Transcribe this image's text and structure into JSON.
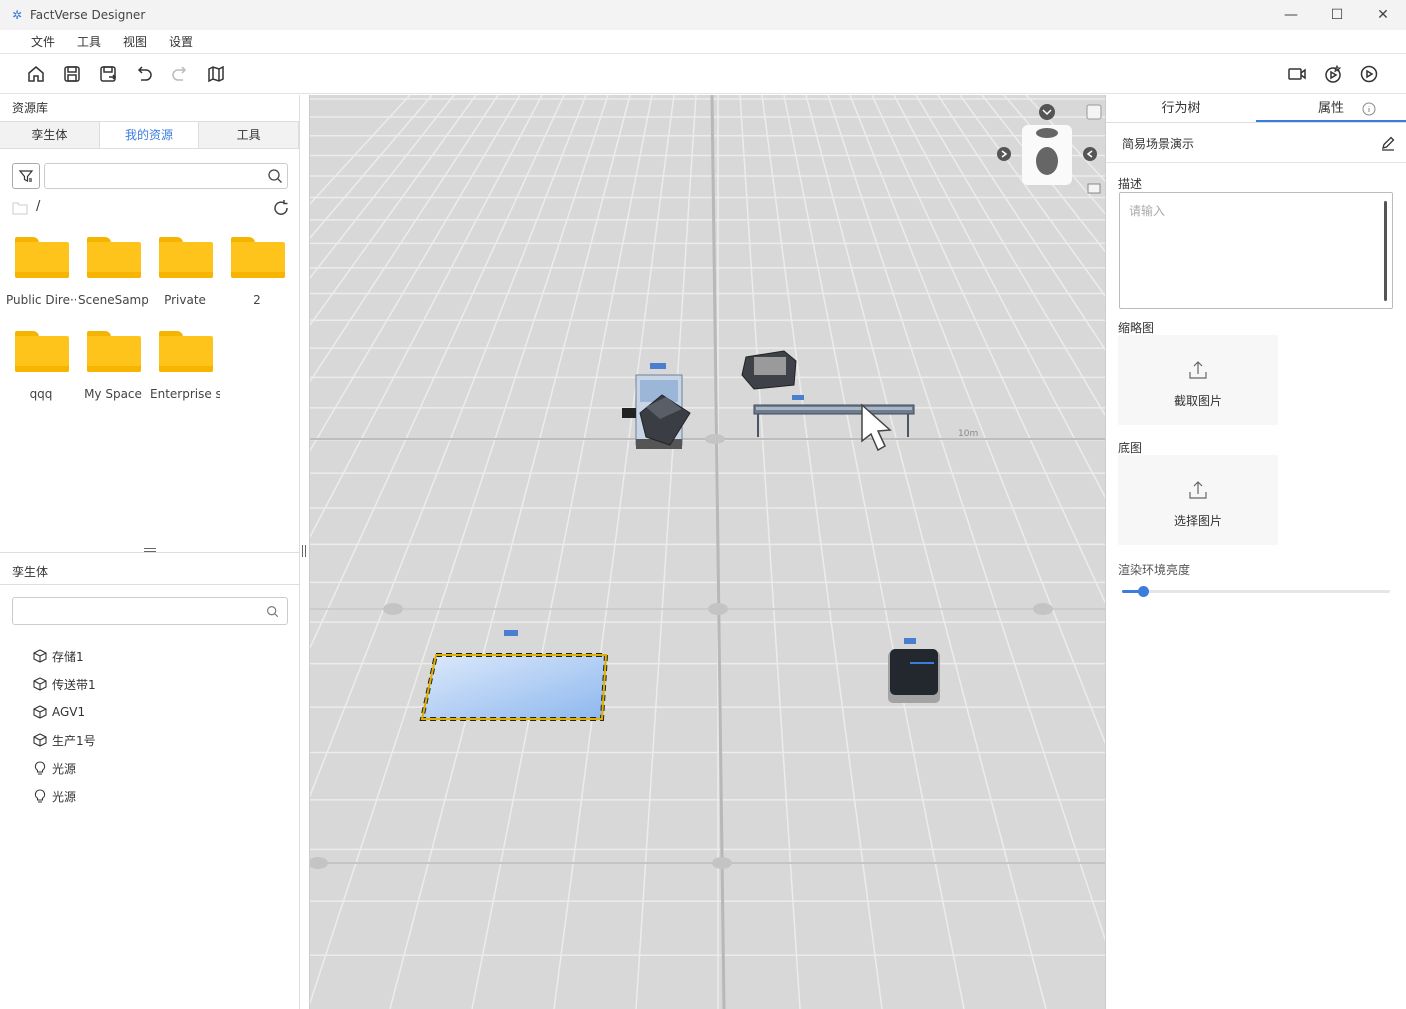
{
  "window": {
    "title": "FactVerse Designer"
  },
  "menu": [
    "文件",
    "工具",
    "视图",
    "设置"
  ],
  "toolbar": {
    "left_icons": [
      "home-icon",
      "save-icon",
      "save-as-icon",
      "undo-icon",
      "redo-icon",
      "map-icon"
    ],
    "right_icons": [
      "camera-icon",
      "record-icon",
      "play-icon"
    ]
  },
  "resources": {
    "title": "资源库",
    "tabs": [
      "孪生体",
      "我的资源",
      "工具"
    ],
    "active_tab": "我的资源",
    "search_placeholder": "",
    "path": "/",
    "folders": [
      "Public Dire···",
      "SceneSample",
      "Private",
      "2",
      "qqq",
      "My Space",
      "Enterprise s···"
    ]
  },
  "twins": {
    "title": "孪生体",
    "search_placeholder": "",
    "items": [
      {
        "label": "存储1",
        "icon": "cube-icon"
      },
      {
        "label": "传送带1",
        "icon": "cube-icon"
      },
      {
        "label": "AGV1",
        "icon": "cube-icon"
      },
      {
        "label": "生产1号",
        "icon": "cube-icon"
      },
      {
        "label": "光源",
        "icon": "bulb-icon"
      },
      {
        "label": "光源",
        "icon": "bulb-icon"
      }
    ]
  },
  "viewport": {
    "scale_label": "10m"
  },
  "properties": {
    "tabs": [
      "行为树",
      "属性"
    ],
    "active_tab": "属性",
    "scene_name": "简易场景演示",
    "description_label": "描述",
    "description_placeholder": "请输入",
    "thumbnail_label": "缩略图",
    "thumbnail_button": "截取图片",
    "base_label": "底图",
    "base_button": "选择图片",
    "brightness_label": "渲染环境亮度",
    "brightness_value": 0.08,
    "colors": {
      "accent": "#3b7ddd"
    }
  }
}
